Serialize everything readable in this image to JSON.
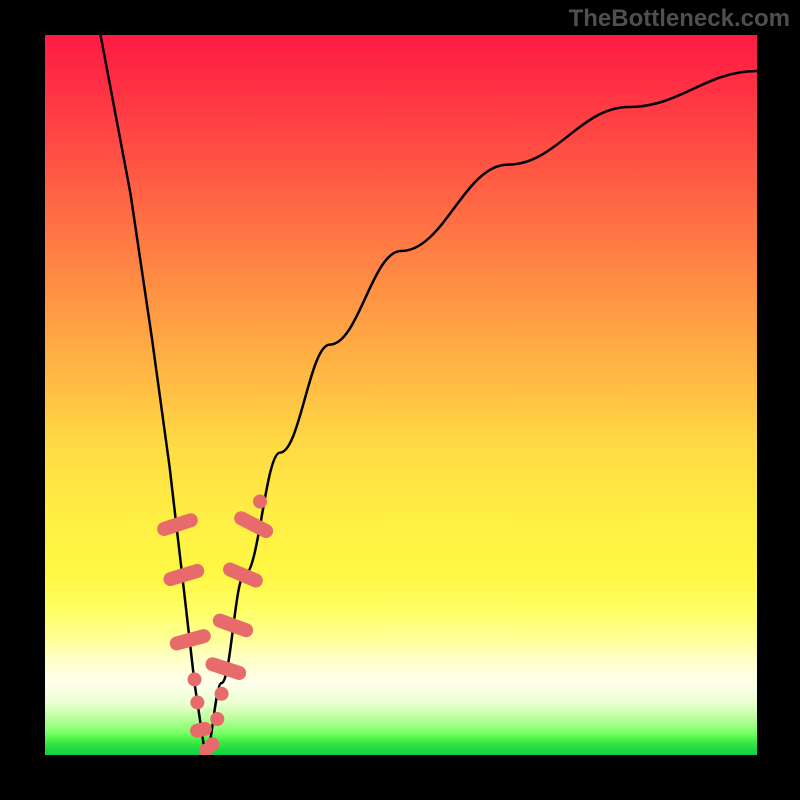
{
  "watermark": "TheBottleneck.com",
  "chart_data": {
    "type": "line",
    "title": "",
    "xlabel": "",
    "ylabel": "",
    "colors": {
      "background_top": "#ff1a44",
      "background_bottom": "#11cc44",
      "curve": "#000000",
      "markers": "#e86b6b",
      "frame": "#000000"
    },
    "curve_description": "V-shaped bottleneck curve with minimum around x=0.225",
    "minimum_x": 0.225,
    "left_branch": [
      {
        "x": 0.078,
        "y": 1.0
      },
      {
        "x": 0.12,
        "y": 0.78
      },
      {
        "x": 0.15,
        "y": 0.58
      },
      {
        "x": 0.175,
        "y": 0.4
      },
      {
        "x": 0.195,
        "y": 0.23
      },
      {
        "x": 0.21,
        "y": 0.1
      },
      {
        "x": 0.225,
        "y": 0.0
      }
    ],
    "right_branch": [
      {
        "x": 0.225,
        "y": 0.0
      },
      {
        "x": 0.248,
        "y": 0.1
      },
      {
        "x": 0.28,
        "y": 0.25
      },
      {
        "x": 0.33,
        "y": 0.42
      },
      {
        "x": 0.4,
        "y": 0.57
      },
      {
        "x": 0.5,
        "y": 0.7
      },
      {
        "x": 0.65,
        "y": 0.82
      },
      {
        "x": 0.82,
        "y": 0.9
      },
      {
        "x": 1.0,
        "y": 0.95
      }
    ],
    "markers": [
      {
        "x": 0.186,
        "y": 0.32,
        "type": "pill",
        "angle": -72
      },
      {
        "x": 0.195,
        "y": 0.25,
        "type": "pill",
        "angle": -73
      },
      {
        "x": 0.204,
        "y": 0.16,
        "type": "pill",
        "angle": -75
      },
      {
        "x": 0.21,
        "y": 0.105,
        "type": "dot"
      },
      {
        "x": 0.214,
        "y": 0.073,
        "type": "dot"
      },
      {
        "x": 0.219,
        "y": 0.035,
        "type": "pill_small",
        "angle": -77
      },
      {
        "x": 0.226,
        "y": 0.006,
        "type": "dot"
      },
      {
        "x": 0.235,
        "y": 0.015,
        "type": "dot"
      },
      {
        "x": 0.242,
        "y": 0.05,
        "type": "dot"
      },
      {
        "x": 0.248,
        "y": 0.085,
        "type": "dot"
      },
      {
        "x": 0.254,
        "y": 0.12,
        "type": "pill",
        "angle": 72
      },
      {
        "x": 0.264,
        "y": 0.18,
        "type": "pill",
        "angle": 70
      },
      {
        "x": 0.278,
        "y": 0.25,
        "type": "pill",
        "angle": 67
      },
      {
        "x": 0.293,
        "y": 0.32,
        "type": "pill",
        "angle": 63
      },
      {
        "x": 0.302,
        "y": 0.352,
        "type": "dot"
      }
    ]
  }
}
